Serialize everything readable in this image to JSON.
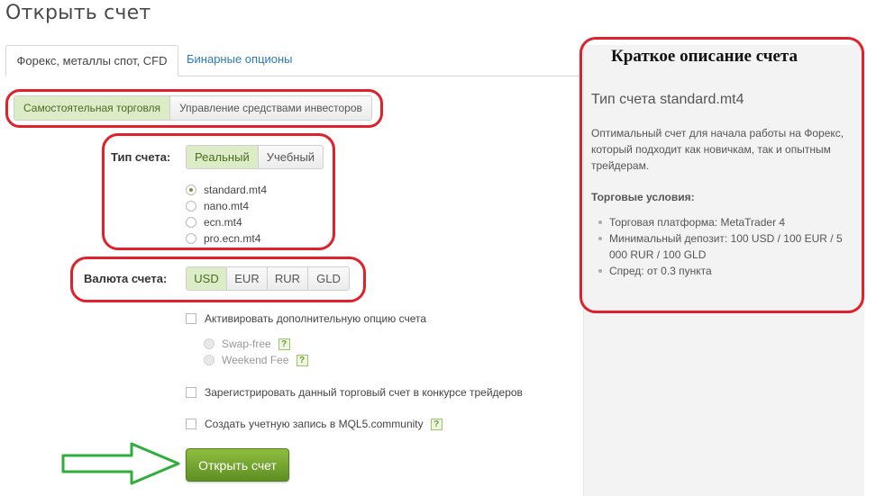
{
  "page": {
    "title": "Открыть счет"
  },
  "tabs": [
    {
      "label": "Форекс, металлы спот, CFD",
      "active": true
    },
    {
      "label": "Бинарные опционы",
      "active": false
    }
  ],
  "trade_mode": {
    "options": [
      "Самостоятельная торговля",
      "Управление средствами инвесторов"
    ],
    "selected": "Самостоятельная торговля"
  },
  "account_type": {
    "label": "Тип счета:",
    "options": [
      "Реальный",
      "Учебный"
    ],
    "selected": "Реальный",
    "plans": [
      "standard.mt4",
      "nano.mt4",
      "ecn.mt4",
      "pro.ecn.mt4"
    ],
    "selected_plan": "standard.mt4"
  },
  "currency": {
    "label": "Валюта счета:",
    "options": [
      "USD",
      "EUR",
      "RUR",
      "GLD"
    ],
    "selected": "USD"
  },
  "extra_option": {
    "label": "Активировать дополнительную опцию счета",
    "sub_options": [
      "Swap-free",
      "Weekend Fee"
    ]
  },
  "contest": {
    "label": "Зарегистрировать данный торговый счет в конкурсе трейдеров"
  },
  "mql5": {
    "label": "Создать учетную запись в MQL5.community"
  },
  "help_glyph": "?",
  "submit": {
    "label": "Открыть счет"
  },
  "side": {
    "heading": "Краткое описание счета",
    "type_title": "Тип счета standard.mt4",
    "description": "Оптимальный счет для начала работы на Форекс, который подходит как новичкам, так и опытным трейдерам.",
    "conditions_title": "Торговые условия:",
    "conditions": [
      "Торговая платформа: MetaTrader 4",
      "Минимальный депозит: 100 USD / 100 EUR / 5 000 RUR / 100 GLD",
      "Спред: от 0.3 пункта"
    ]
  },
  "colors": {
    "accent_green": "#6b9b34",
    "selected_bg": "#dcecc6",
    "annotation_red": "#e0202a",
    "arrow_green": "#2fae3c",
    "link_blue": "#2a7ab8"
  }
}
